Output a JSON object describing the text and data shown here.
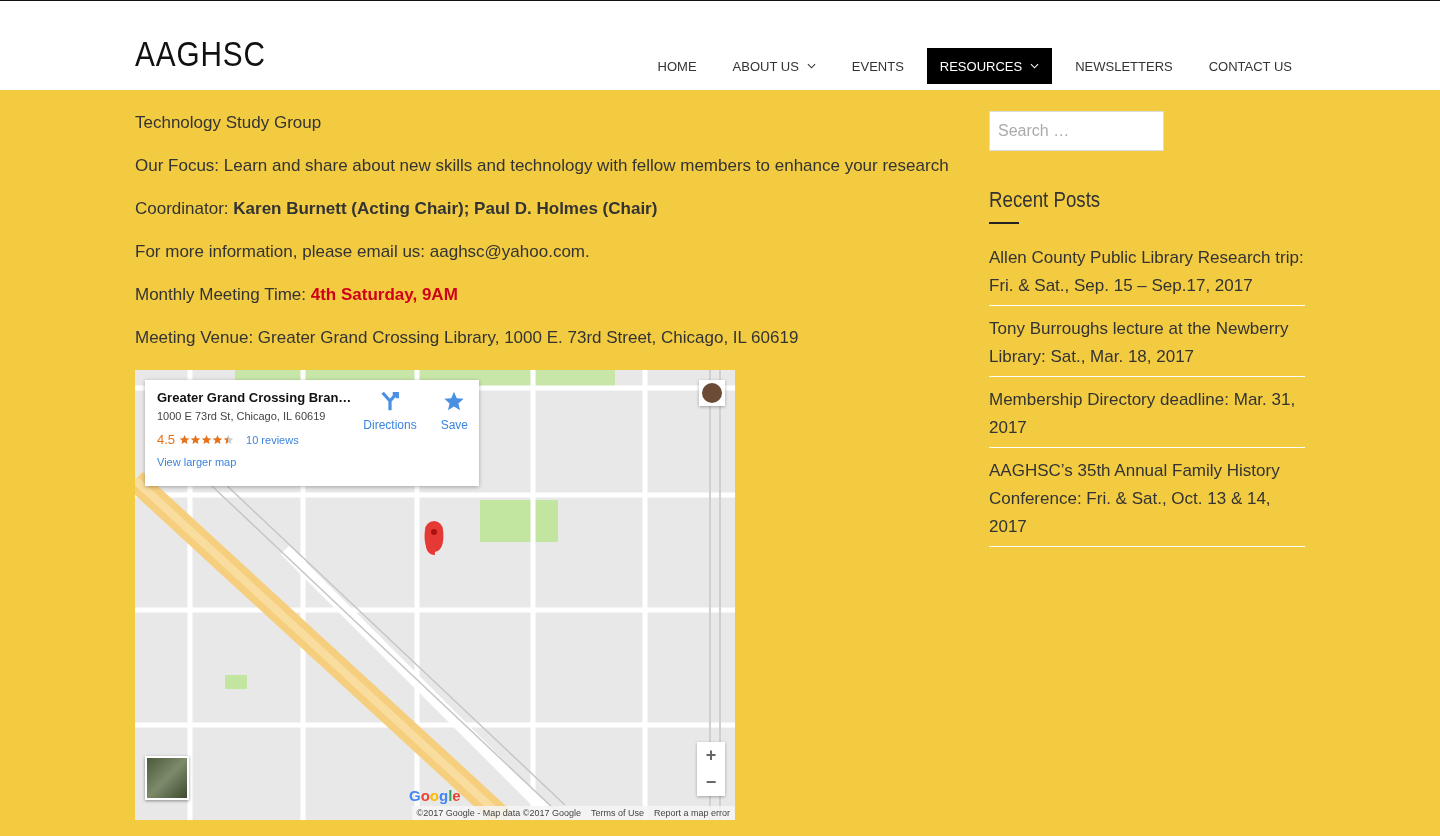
{
  "site": {
    "title": "AAGHSC"
  },
  "nav": [
    {
      "label": "HOME",
      "dropdown": false,
      "selected": false
    },
    {
      "label": "ABOUT US",
      "dropdown": true,
      "selected": false
    },
    {
      "label": "EVENTS",
      "dropdown": false,
      "selected": false
    },
    {
      "label": "RESOURCES",
      "dropdown": true,
      "selected": true
    },
    {
      "label": "NEWSLETTERS",
      "dropdown": false,
      "selected": false
    },
    {
      "label": "CONTACT US",
      "dropdown": false,
      "selected": false
    }
  ],
  "content": {
    "paragraphs": [
      {
        "text": "Technology Study Group"
      },
      {
        "text": "Our Focus: Learn and share about new skills and technology with fellow members to enhance your research"
      },
      {
        "text": "Coordinator: **Karen Burnett (Acting Chair); Paul D. Holmes (Chair)**"
      },
      {
        "text": "For more information, please email us: aaghsc@yahoo.com."
      },
      {
        "text": "Monthly Meeting Time: ",
        "highlight": "4th Saturday, 9AM"
      },
      {
        "text": "Meeting Venue: Greater Grand Crossing Library, 1000 E. 73rd Street, Chicago, IL 60619"
      }
    ]
  },
  "map": {
    "kind": "picture",
    "place_card": {
      "name": "Greater Grand Crossing Bran…",
      "address": "1000 E 73rd St, Chicago, IL 60619",
      "rating": "4.5",
      "stars": 4.5,
      "reviews": "10 reviews",
      "larger_map_link": "View larger map",
      "directions": "Directions",
      "save": "Save"
    },
    "zoom_in": "+",
    "zoom_out": "−",
    "logo": "Google",
    "attribution": [
      "©2017 Google - Map data ©2017 Google",
      "Terms of Use",
      "Report a map error"
    ]
  },
  "sidebar": {
    "search": {
      "placeholder": "Search …"
    },
    "recent_posts": {
      "title": "Recent Posts",
      "items": [
        "Allen County Public Library Research trip: Fri. & Sat., Sep. 15 – Sep.17, 2017",
        "Tony Burroughs lecture at the Newberry Library: Sat., Mar. 18, 2017",
        "Membership Directory deadline: Mar. 31, 2017",
        "AAGHSC’s 35th Annual Family History Conference: Fri. & Sat., Oct. 13 & 14, 2017"
      ]
    }
  }
}
